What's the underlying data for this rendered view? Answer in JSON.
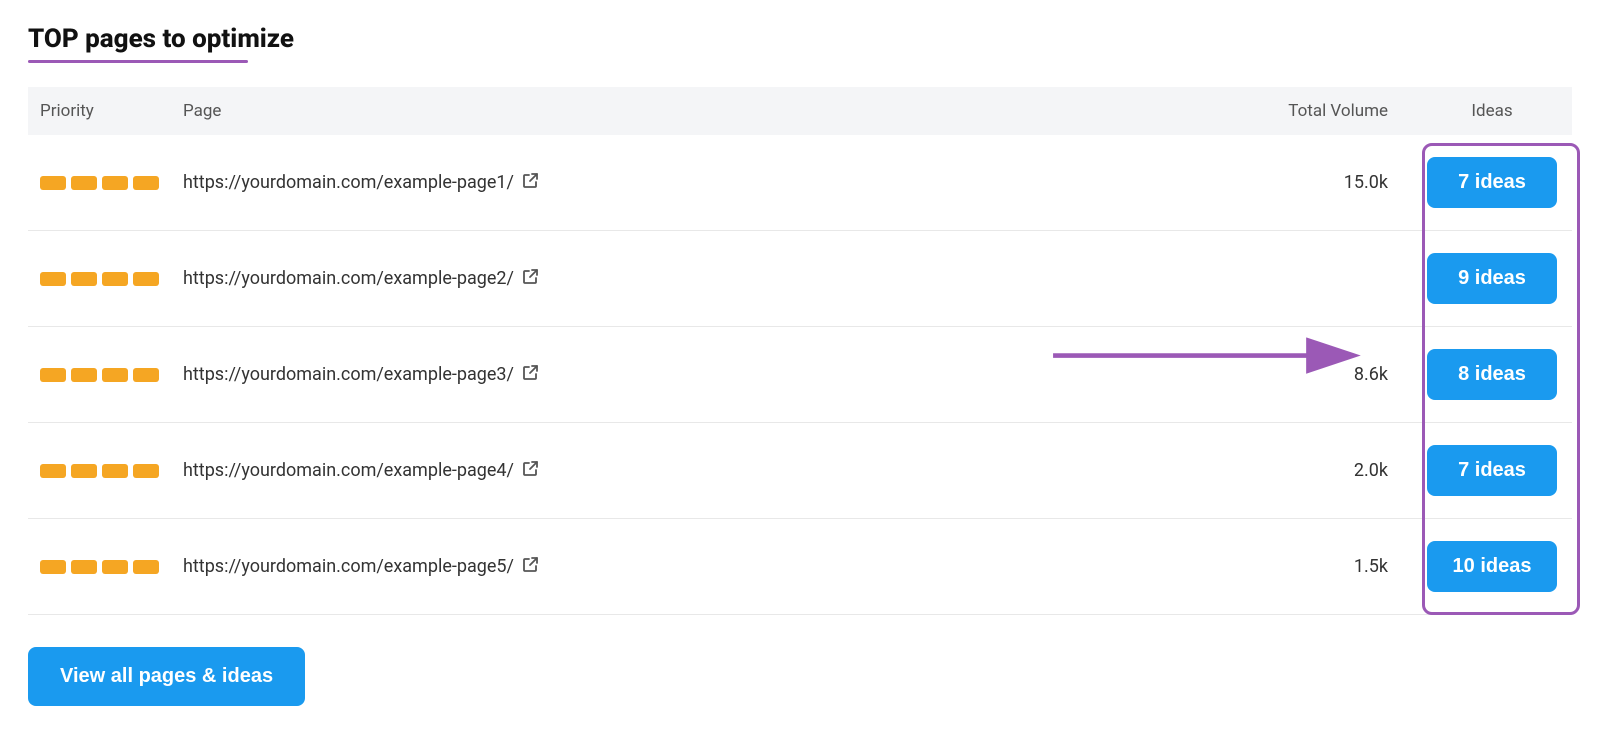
{
  "title": "TOP pages to optimize",
  "columns": {
    "priority": "Priority",
    "page": "Page",
    "volume": "Total Volume",
    "ideas": "Ideas"
  },
  "rows": [
    {
      "priority_bars": 4,
      "page_url": "https://yourdomain.com/example-page1/",
      "volume": "15.0k",
      "ideas_label": "7 ideas",
      "show_volume": true
    },
    {
      "priority_bars": 4,
      "page_url": "https://yourdomain.com/example-page2/",
      "volume": "",
      "ideas_label": "9 ideas",
      "show_volume": false
    },
    {
      "priority_bars": 4,
      "page_url": "https://yourdomain.com/example-page3/",
      "volume": "8.6k",
      "ideas_label": "8 ideas",
      "show_volume": true
    },
    {
      "priority_bars": 4,
      "page_url": "https://yourdomain.com/example-page4/",
      "volume": "2.0k",
      "ideas_label": "7 ideas",
      "show_volume": true
    },
    {
      "priority_bars": 4,
      "page_url": "https://yourdomain.com/example-page5/",
      "volume": "1.5k",
      "ideas_label": "10 ideas",
      "show_volume": true
    }
  ],
  "view_all_label": "View all pages & ideas",
  "colors": {
    "accent_purple": "#9b59b6",
    "accent_blue": "#1a9aef",
    "priority_bar": "#f5a623"
  }
}
